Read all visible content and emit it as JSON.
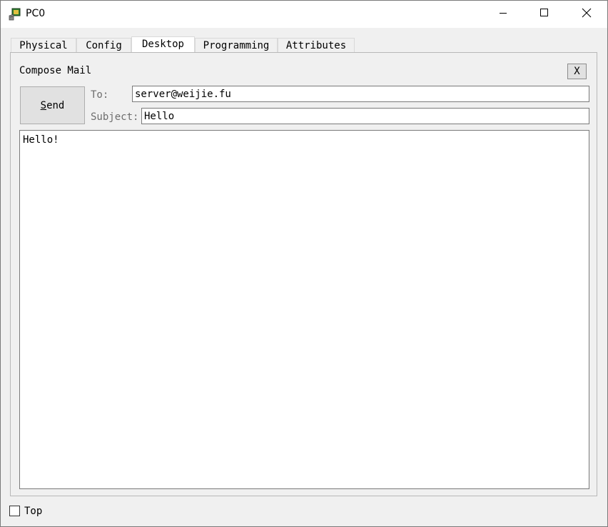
{
  "window": {
    "title": "PC0",
    "icon": "pc-app-icon",
    "controls": {
      "minimize_icon": "minimize-icon",
      "maximize_icon": "maximize-icon",
      "close_icon": "close-icon"
    }
  },
  "tabs": [
    {
      "label": "Physical",
      "active": false
    },
    {
      "label": "Config",
      "active": false
    },
    {
      "label": "Desktop",
      "active": true
    },
    {
      "label": "Programming",
      "active": false
    },
    {
      "label": "Attributes",
      "active": false
    }
  ],
  "compose": {
    "title": "Compose Mail",
    "close_label": "X",
    "send_label_underlined": "S",
    "send_label_rest": "end",
    "to_label": "To:",
    "to_value": "server@weijie.fu",
    "subject_label": "Subject:",
    "subject_value": "Hello",
    "body_value": "Hello!"
  },
  "footer": {
    "top_label": "Top",
    "top_checked": false
  },
  "colors": {
    "window_bg": "#f0f0f0",
    "titlebar_bg": "#ffffff",
    "button_bg": "#e1e1e1"
  }
}
